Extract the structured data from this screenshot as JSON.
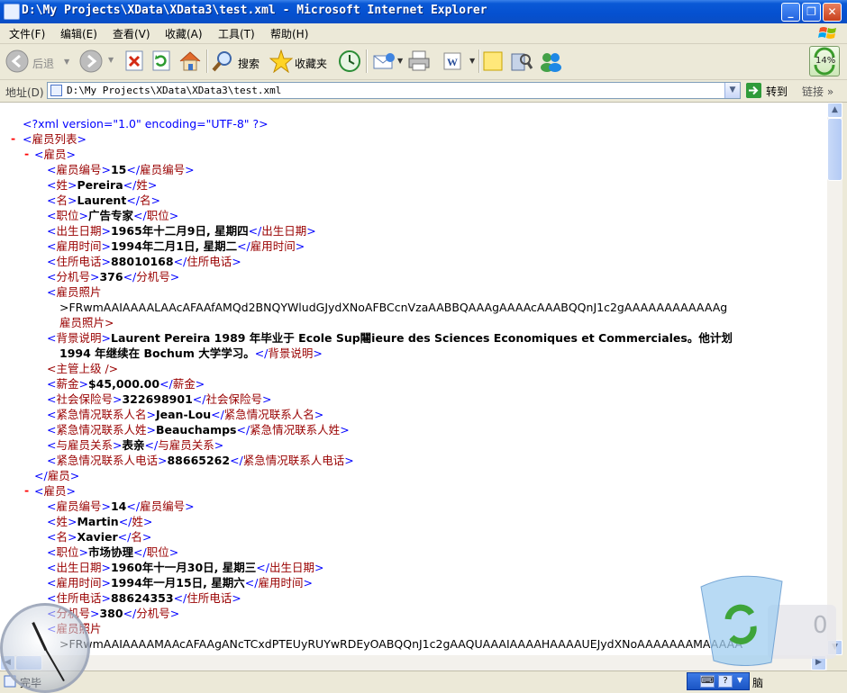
{
  "window": {
    "title": "D:\\My Projects\\XData\\XData3\\test.xml - Microsoft Internet Explorer",
    "buttons": {
      "minimize": "_",
      "maximize": "❐",
      "close": "✕"
    }
  },
  "menu": [
    "文件(F)",
    "编辑(E)",
    "查看(V)",
    "收藏(A)",
    "工具(T)",
    "帮助(H)"
  ],
  "toolbar": {
    "back": "后退",
    "search": "搜索",
    "favorites": "收藏夹",
    "zoom_badge": "14%"
  },
  "address": {
    "label": "地址(D)",
    "value": "D:\\My Projects\\XData\\XData3\\test.xml",
    "go": "转到",
    "links": "链接 »"
  },
  "xml": {
    "declaration": "<?xml version=\"1.0\" encoding=\"UTF-8\" ?>",
    "root_tag": "雇员列表",
    "employee_tag": "雇员",
    "employees": [
      {
        "fields": [
          {
            "tag": "雇员编号",
            "value": "15"
          },
          {
            "tag": "姓",
            "value": "Pereira"
          },
          {
            "tag": "名",
            "value": "Laurent"
          },
          {
            "tag": "职位",
            "value": "广告专家"
          },
          {
            "tag": "出生日期",
            "value": "1965年十二月9日, 星期四"
          },
          {
            "tag": "雇用时间",
            "value": "1994年二月1日, 星期二"
          },
          {
            "tag": "住所电话",
            "value": "88010168"
          },
          {
            "tag": "分机号",
            "value": "376"
          }
        ],
        "photo_tag": "雇员照片",
        "photo_data": ">FRwmAAIAAAALAAcAFAAfAMQd2BNQYWludGJydXNoAFBCcnVzaAABBQAAAgAAAAcAAABQQnJ1c2gAAAAAAAAAAAAg",
        "photo_close": "雇员照片>",
        "background_tag": "背景说明",
        "background_line1": "Laurent Pereira 1989 年毕业于  Ecole Sup闀ieure des Sciences Economiques et Commerciales。他计划",
        "background_line2": "1994 年继续在  Bochum 大学学习。",
        "manager_tag": "<主管上级 />",
        "fields2": [
          {
            "tag": "薪金",
            "value": "$45,000.00"
          },
          {
            "tag": "社会保险号",
            "value": "322698901"
          },
          {
            "tag": "紧急情况联系人名",
            "value": "Jean-Lou"
          },
          {
            "tag": "紧急情况联系人姓",
            "value": "Beauchamps"
          },
          {
            "tag": "与雇员关系",
            "value": "表亲"
          },
          {
            "tag": "紧急情况联系人电话",
            "value": "88665262"
          }
        ]
      },
      {
        "fields": [
          {
            "tag": "雇员编号",
            "value": "14"
          },
          {
            "tag": "姓",
            "value": "Martin"
          },
          {
            "tag": "名",
            "value": "Xavier"
          },
          {
            "tag": "职位",
            "value": "市场协理"
          },
          {
            "tag": "出生日期",
            "value": "1960年十一月30日, 星期三"
          },
          {
            "tag": "雇用时间",
            "value": "1994年一月15日, 星期六"
          },
          {
            "tag": "住所电话",
            "value": "88624353"
          },
          {
            "tag": "分机号",
            "value": "380"
          }
        ],
        "photo_tag": "雇员照片",
        "photo_data": ">FRwmAAIAAAAMAAcAFAAgANcTCxdPTEUyRUYwRDEyOABQQnJ1c2gAAQUAAAIAAAAHAAAAUEJydXNoAAAAAAAMAAAAA"
      }
    ]
  },
  "status": {
    "text": "完毕",
    "ime_label": "脑"
  },
  "gadget": {
    "recycle_count": "0"
  }
}
